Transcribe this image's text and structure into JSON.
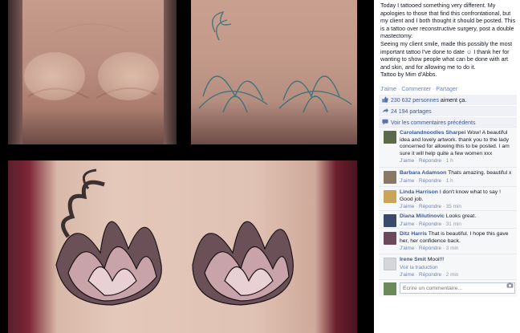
{
  "post": {
    "caption_lines": [
      "Today I tattooed something very different. My apologies to those that find this confrontational, but my client and I both thought it should be posted. This is a tattoo over reconstructive surgery, post a double mastectomy.",
      "Seeing my client smile, made this possibly the most important tattoo I've done to date ☺ I thank her for wanting to show people what can be done with art and skin, and for allowing me to do it.",
      "Tattoo by Mim d'Abbs."
    ],
    "actions": {
      "like": "J'aime",
      "comment": "Commenter",
      "share": "Partager"
    }
  },
  "stats": {
    "likes_count": "230 632 personnes",
    "likes_suffix": "aiment ça.",
    "shares": "24 194 partages",
    "previous_comments": "Voir les commentaires précédents"
  },
  "comments": [
    {
      "name": "Carolandnoodles Sharpei",
      "text": "Wow! A beautiful idea and lovely artwork. thank you to the lady concerned for allowing this to be posted. I am sure it will help quite a few women xxx",
      "like": "J'aime",
      "reply": "Répondre",
      "time": "1 h",
      "avatar_color": "#5b6b4a"
    },
    {
      "name": "Barbara Adamson",
      "text": "Thats amazing. beautiful x",
      "like": "J'aime",
      "reply": "Répondre",
      "time": "1 h",
      "avatar_color": "#8a7866"
    },
    {
      "name": "Linda Harrison",
      "text": "I don't know what to say ! Good job.",
      "like": "J'aime",
      "reply": "Répondre",
      "time": "35 min",
      "avatar_color": "#c9a55a"
    },
    {
      "name": "Diana Milutinovic",
      "text": "Looks great.",
      "like": "J'aime",
      "reply": "Répondre",
      "time": "31 min",
      "avatar_color": "#3a4a6a"
    },
    {
      "name": "Ditz Harris",
      "text": "That is beautiful. I hope this gave her, her confidence back.",
      "like": "J'aime",
      "reply": "Répondre",
      "time": "3 min",
      "avatar_color": "#6a4a5a"
    },
    {
      "name": "Irene Smit",
      "text": "Mooi!!!",
      "translation": "Voir la traduction",
      "like": "J'aime",
      "reply": "Répondre",
      "time": "2 min",
      "avatar_color": "#d4d6da"
    }
  ],
  "compose": {
    "placeholder": "Écrire un commentaire...",
    "avatar_color": "#6b8a5a"
  },
  "colors": {
    "link": "#3b5998",
    "muted": "#9197a3",
    "background": "#000000",
    "panel": "#f6f7f9"
  }
}
